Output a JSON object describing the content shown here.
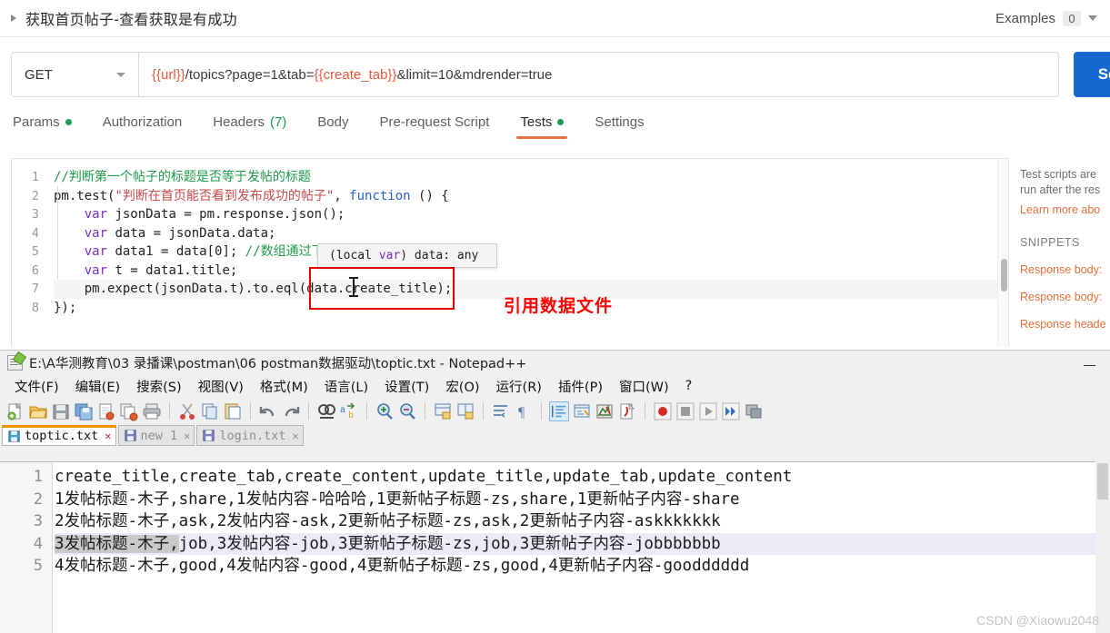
{
  "postman": {
    "request_title": "获取首页帖子-查看获取是有成功",
    "examples_label": "Examples",
    "examples_count": "0",
    "method": "GET",
    "url_parts": [
      {
        "text": "{{url}}",
        "kind": "var"
      },
      {
        "text": "/topics?page=1&tab=",
        "kind": "plain"
      },
      {
        "text": "{{create_tab}}",
        "kind": "var"
      },
      {
        "text": "&limit=10&mdrender=true",
        "kind": "plain"
      }
    ],
    "url_full": "{{url}}/topics?page=1&tab={{create_tab}}&limit=10&mdrender=true",
    "send_label": "Send",
    "tabs": [
      {
        "label": "Params",
        "dot": true,
        "active": false
      },
      {
        "label": "Authorization",
        "dot": false,
        "active": false
      },
      {
        "label": "Headers (7)",
        "dot": false,
        "active": false
      },
      {
        "label": "Body",
        "dot": false,
        "active": false
      },
      {
        "label": "Pre-request Script",
        "dot": false,
        "active": false
      },
      {
        "label": "Tests",
        "dot": true,
        "active": true
      },
      {
        "label": "Settings",
        "dot": false,
        "active": false
      }
    ],
    "code_lines": [
      {
        "n": "1",
        "segments": [
          {
            "t": "//判断第一个帖子的标题是否等于发帖的标题",
            "c": "tok-cmt"
          }
        ]
      },
      {
        "n": "2",
        "segments": [
          {
            "t": "pm.test(",
            "c": "tok-plain"
          },
          {
            "t": "\"判断在首页能否看到发布成功的帖子\"",
            "c": "tok-str"
          },
          {
            "t": ", ",
            "c": "tok-plain"
          },
          {
            "t": "function",
            "c": "tok-fn"
          },
          {
            "t": " () {",
            "c": "tok-plain"
          }
        ]
      },
      {
        "n": "3",
        "segments": [
          {
            "t": "    ",
            "c": "tok-plain"
          },
          {
            "t": "var",
            "c": "tok-kw"
          },
          {
            "t": " jsonData = pm.response.json();",
            "c": "tok-plain"
          }
        ]
      },
      {
        "n": "4",
        "segments": [
          {
            "t": "    ",
            "c": "tok-plain"
          },
          {
            "t": "var",
            "c": "tok-kw"
          },
          {
            "t": " data = jsonData.data;",
            "c": "tok-plain"
          }
        ]
      },
      {
        "n": "5",
        "segments": [
          {
            "t": "    ",
            "c": "tok-plain"
          },
          {
            "t": "var",
            "c": "tok-kw"
          },
          {
            "t": " data1 = data[0]; ",
            "c": "tok-plain"
          },
          {
            "t": "//数组通过下标取值，从0开始",
            "c": "tok-cmt"
          }
        ]
      },
      {
        "n": "6",
        "segments": [
          {
            "t": "    ",
            "c": "tok-plain"
          },
          {
            "t": "var",
            "c": "tok-kw"
          },
          {
            "t": " t = data1.title;",
            "c": "tok-plain"
          }
        ]
      },
      {
        "n": "7",
        "segments": [
          {
            "t": "    pm.expect(jsonData.t).to.eql(data.create_title);",
            "c": "tok-plain"
          }
        ]
      },
      {
        "n": "8",
        "segments": [
          {
            "t": "});",
            "c": "tok-plain"
          }
        ]
      }
    ],
    "tooltip": {
      "prefix": "(local ",
      "keyword": "var",
      "suffix": ") data: any"
    },
    "annotation": "引用数据文件",
    "sidebar": {
      "line1": "Test scripts are ",
      "line2": "run after the res",
      "learn_more": "Learn more abo",
      "snippets_header": "SNIPPETS",
      "snippets": [
        "Response body:",
        "Response body:",
        "Response heade"
      ]
    }
  },
  "notepad": {
    "title": "E:\\A华测教育\\03 录播课\\postman\\06 postman数据驱动\\toptic.txt - Notepad++",
    "menus": [
      "文件(F)",
      "编辑(E)",
      "搜索(S)",
      "视图(V)",
      "格式(M)",
      "语言(L)",
      "设置(T)",
      "宏(O)",
      "运行(R)",
      "插件(P)",
      "窗口(W)",
      "?"
    ],
    "toolbar_icons": [
      "new-file-icon",
      "open-file-icon",
      "save-icon",
      "save-all-icon",
      "close-file-icon",
      "close-all-icon",
      "print-icon",
      "sep",
      "cut-icon",
      "copy-icon",
      "paste-icon",
      "sep",
      "undo-icon",
      "redo-icon",
      "sep",
      "find-icon",
      "replace-icon",
      "sep",
      "zoom-in-icon",
      "zoom-out-icon",
      "sep",
      "sync-vertical-icon",
      "sync-horizontal-icon",
      "sep",
      "word-wrap-icon",
      "show-symbol-icon",
      "sep",
      "indent-guide-icon",
      "user-language-icon",
      "doc-map-icon",
      "function-list-icon",
      "sep",
      "record-macro-icon",
      "stop-macro-icon",
      "play-macro-icon",
      "run-multiple-icon",
      "save-macro-icon"
    ],
    "tabs": [
      {
        "label": "toptic.txt",
        "active": true
      },
      {
        "label": "new 1",
        "active": false
      },
      {
        "label": "login.txt",
        "active": false
      }
    ],
    "lines": [
      {
        "n": "1",
        "text": "create_title,create_tab,create_content,update_title,update_tab,update_content",
        "current": false,
        "sel_end": 0
      },
      {
        "n": "2",
        "text": "1发帖标题-木子,share,1发帖内容-哈哈哈,1更新帖子标题-zs,share,1更新帖子内容-share",
        "current": false,
        "sel_end": 0
      },
      {
        "n": "3",
        "text": "2发帖标题-木子,ask,2发帖内容-ask,2更新帖子标题-zs,ask,2更新帖子内容-askkkkkkk",
        "current": false,
        "sel_end": 0
      },
      {
        "n": "4",
        "text": "3发帖标题-木子,job,3发帖内容-job,3更新帖子标题-zs,job,3更新帖子内容-jobbbbbbb",
        "current": true,
        "sel_end": 9
      },
      {
        "n": "5",
        "text": "4发帖标题-木子,good,4发帖内容-good,4更新帖子标题-zs,good,4更新帖子内容-goodddddd",
        "current": false,
        "sel_end": 0
      }
    ]
  },
  "watermark": "CSDN @Xiaowu2048",
  "colors": {
    "accent_orange": "#e8703a",
    "send_blue": "#1668cf",
    "annotation_red": "#ff0000",
    "green_dot": "#1a9e52"
  }
}
